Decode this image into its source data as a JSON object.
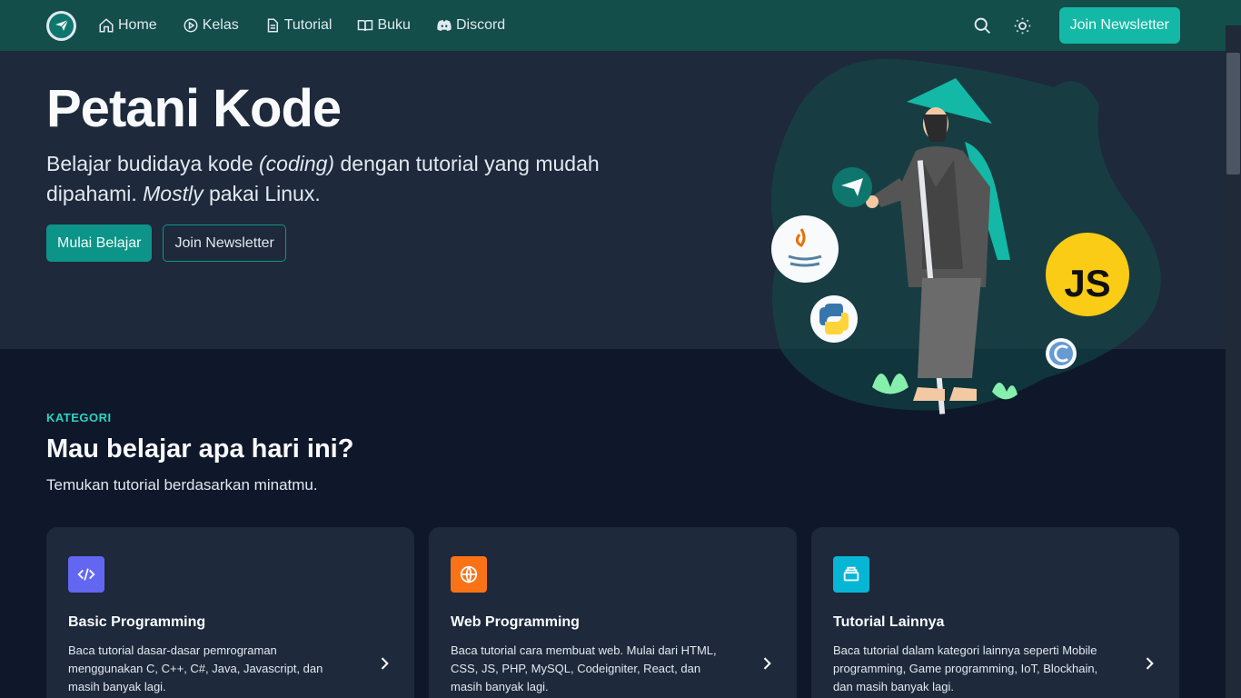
{
  "navbar": {
    "logo_name": "petani-kode-logo",
    "items": [
      {
        "label": "Home",
        "icon": "home-icon"
      },
      {
        "label": "Kelas",
        "icon": "play-circle-icon"
      },
      {
        "label": "Tutorial",
        "icon": "document-icon"
      },
      {
        "label": "Buku",
        "icon": "book-icon"
      },
      {
        "label": "Discord",
        "icon": "discord-icon"
      }
    ],
    "newsletter_label": "Join Newsletter"
  },
  "hero": {
    "title": "Petani Kode",
    "subtitle_part1": "Belajar budidaya kode ",
    "subtitle_italic1": "(coding)",
    "subtitle_part2": " dengan tutorial yang mudah dipahami. ",
    "subtitle_italic2": "Mostly",
    "subtitle_part3": " pakai Linux.",
    "primary_button": "Mulai Belajar",
    "secondary_button": "Join Newsletter",
    "js_badge": "JS"
  },
  "kategori": {
    "label": "KATEGORI",
    "title": "Mau belajar apa hari ini?",
    "subtitle": "Temukan tutorial berdasarkan minatmu.",
    "cards": [
      {
        "title": "Basic Programming",
        "desc": "Baca tutorial dasar-dasar pemrograman menggunakan C, C++, C#, Java, Javascript, dan masih banyak lagi.",
        "icon": "code-icon",
        "color": "#6366f1"
      },
      {
        "title": "Web Programming",
        "desc": "Baca tutorial cara membuat web. Mulai dari HTML, CSS, JS, PHP, MySQL, Codeigniter, React, dan masih banyak lagi.",
        "icon": "globe-icon",
        "color": "#f97316"
      },
      {
        "title": "Tutorial Lainnya",
        "desc": "Baca tutorial dalam kategori lainnya seperti Mobile programming, Game programming, IoT, Blockhain, dan masih banyak lagi.",
        "icon": "stack-icon",
        "color": "#06b6d4"
      }
    ]
  },
  "colors": {
    "navbar_bg": "#134e4a",
    "accent": "#14b8a6",
    "hero_bg": "#1e293b",
    "page_bg": "#0f172a"
  }
}
